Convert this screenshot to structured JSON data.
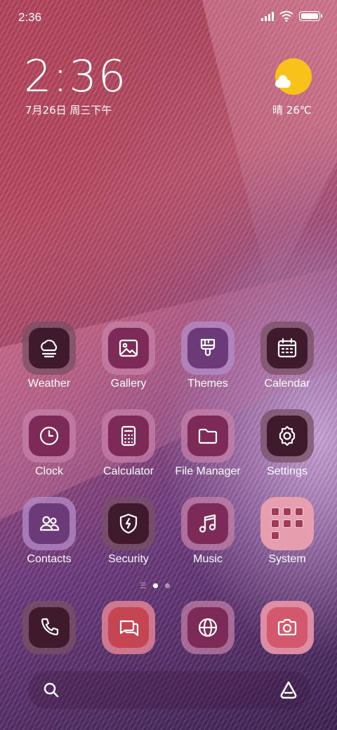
{
  "status_bar": {
    "time": "2:36"
  },
  "clock_widget": {
    "time": "2:36",
    "date": "7月26日 周三下午"
  },
  "weather_widget": {
    "condition": "晴",
    "temperature": "26℃",
    "icon": "sun-cloud-icon"
  },
  "apps": [
    {
      "label": "Weather",
      "icon": "weather-icon"
    },
    {
      "label": "Gallery",
      "icon": "gallery-icon"
    },
    {
      "label": "Themes",
      "icon": "brush-icon"
    },
    {
      "label": "Calendar",
      "icon": "calendar-icon"
    },
    {
      "label": "Clock",
      "icon": "clock-icon"
    },
    {
      "label": "Calculator",
      "icon": "calculator-icon"
    },
    {
      "label": "File Manager",
      "icon": "folder-icon"
    },
    {
      "label": "Settings",
      "icon": "gear-icon"
    },
    {
      "label": "Contacts",
      "icon": "contacts-icon"
    },
    {
      "label": "Security",
      "icon": "shield-icon"
    },
    {
      "label": "Music",
      "icon": "music-note-icon"
    },
    {
      "label": "System",
      "icon": "folder-grid-icon"
    }
  ],
  "dock": [
    {
      "icon": "phone-icon"
    },
    {
      "icon": "messages-icon"
    },
    {
      "icon": "browser-globe-icon"
    },
    {
      "icon": "camera-icon"
    }
  ],
  "page_indicator": {
    "pages": 2,
    "current": 1
  },
  "search_bar": {
    "left_icon": "search-icon",
    "right_icon": "assistant-icon"
  }
}
